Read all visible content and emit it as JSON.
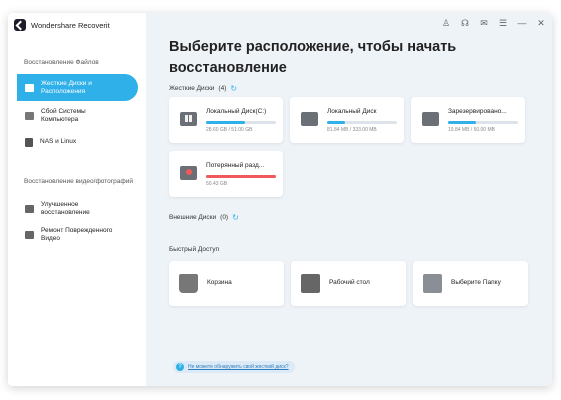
{
  "app": {
    "title": "Wondershare Recoverit"
  },
  "sidebar": {
    "section_files": "Восстановление Файлов",
    "section_video": "Восстановление видео/фотографий",
    "items": [
      {
        "label_1": "Жесткие Диски и",
        "label_2": "Расположения",
        "icon": "hard-drive-icon",
        "active": true
      },
      {
        "label_1": "Сбой Системы",
        "label_2": "Компьютера",
        "icon": "computer-icon",
        "active": false
      },
      {
        "label_1": "NAS и Linux",
        "label_2": "",
        "icon": "nas-icon",
        "active": false
      },
      {
        "label_1": "Улучшенное",
        "label_2": "восстановление",
        "icon": "photo-icon",
        "active": false
      },
      {
        "label_1": "Ремонт Поврежденного",
        "label_2": "Видео",
        "icon": "video-repair-icon",
        "active": false
      }
    ]
  },
  "window_controls": [
    "user-icon",
    "support-icon",
    "mail-icon",
    "menu-icon",
    "minimize-icon",
    "close-icon"
  ],
  "main": {
    "title_1": "Выберите расположение, чтобы начать",
    "title_2": "восстановление",
    "hard_drives": {
      "title": "Жесткие Диски",
      "count": "(4)",
      "drives": [
        {
          "name": "Локальный Диск(C:)",
          "size": "28.60 GB / 51.00 GB",
          "used_fraction": 0.56,
          "color": "#2fb0e8"
        },
        {
          "name": "Локальный Диск",
          "size": "81.84 MB / 333.00 MB",
          "used_fraction": 0.25,
          "color": "#2fb0e8"
        },
        {
          "name": "Зарезервировано...",
          "size": "19.84 MB / 50.00 MB",
          "used_fraction": 0.4,
          "color": "#2fb0e8"
        },
        {
          "name": "Потерянный разд...",
          "size": "50.43 GB",
          "used_fraction": 1.0,
          "color": "#f05a5a"
        }
      ]
    },
    "external": {
      "title": "Внешние Диски",
      "count": "(0)"
    },
    "quick_access": {
      "title": "Быстрый Доступ",
      "items": [
        {
          "label": "Корзина",
          "icon": "trash-icon"
        },
        {
          "label": "Рабочий стол",
          "icon": "desktop-icon"
        },
        {
          "label": "Выберите Папку",
          "icon": "folder-icon"
        }
      ]
    },
    "help_link": "Не можете обнаружить свой жесткий диск?"
  },
  "colors": {
    "accent": "#2fb0e8",
    "lost": "#f05a5a"
  }
}
